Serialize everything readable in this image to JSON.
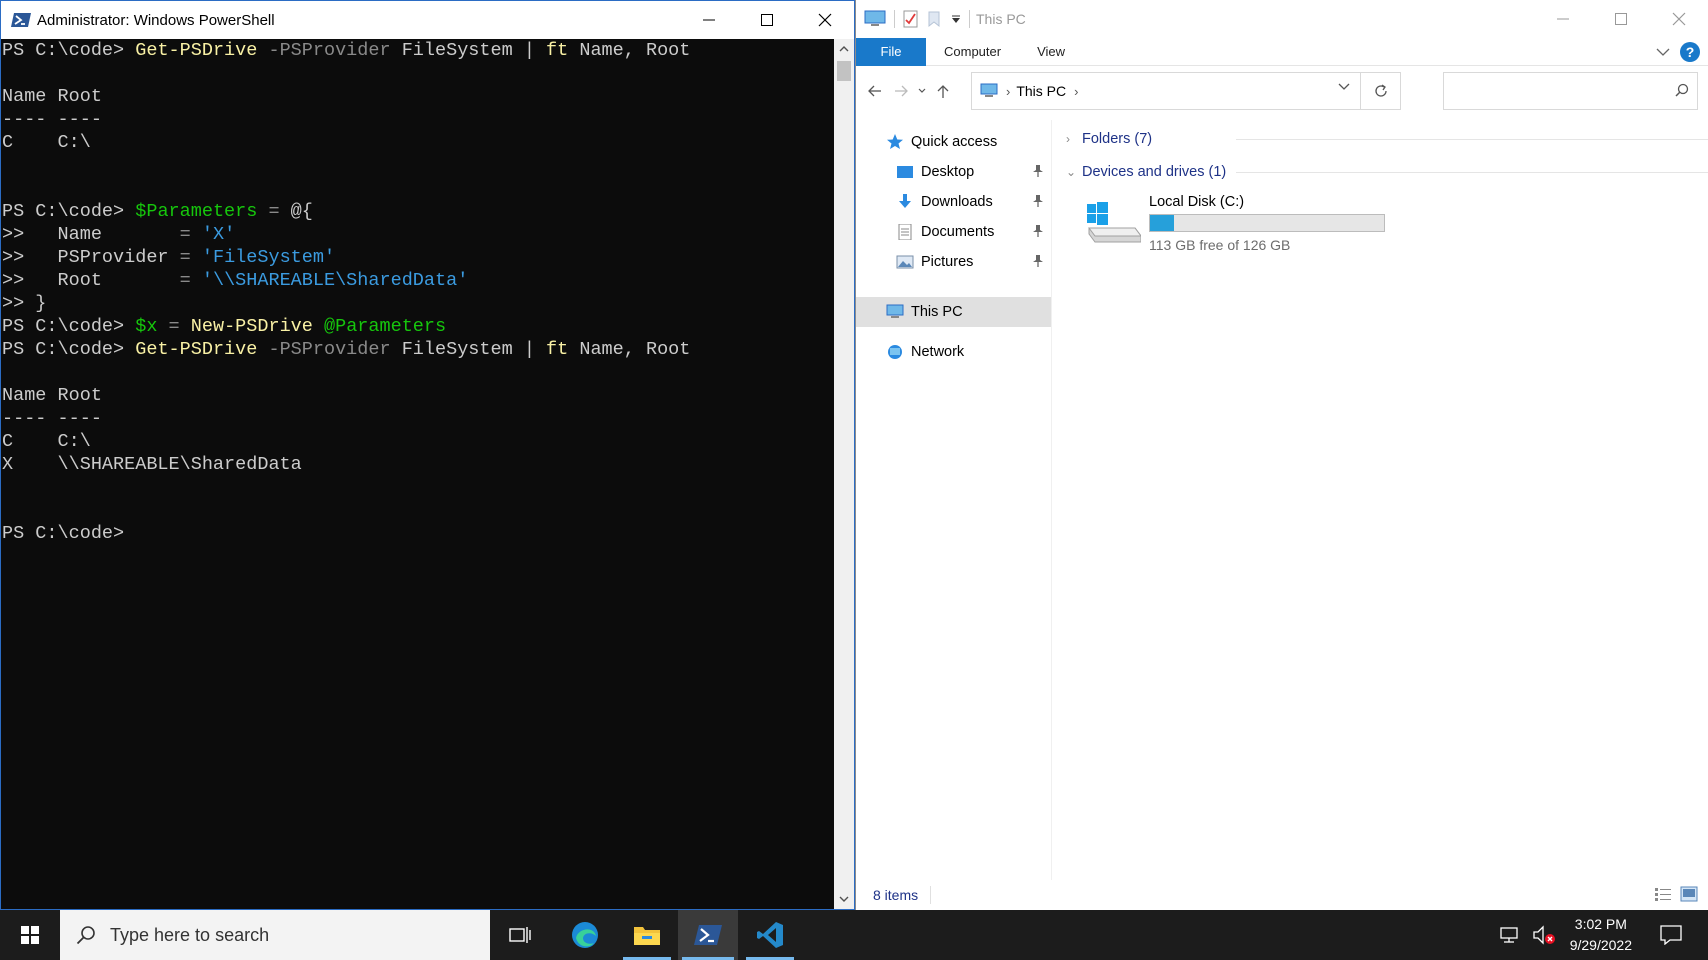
{
  "powershell": {
    "title": "Administrator: Windows PowerShell",
    "lines": [
      [
        {
          "t": "PS C:\\code> ",
          "c": ""
        },
        {
          "t": "Get-PSDrive",
          "c": "c-cmd"
        },
        {
          "t": " -PSProvider",
          "c": "c-param"
        },
        {
          "t": " FileSystem | ",
          "c": ""
        },
        {
          "t": "ft",
          "c": "c-cmd"
        },
        {
          "t": " Name, Root",
          "c": ""
        }
      ],
      [],
      [
        {
          "t": "Name Root",
          "c": ""
        }
      ],
      [
        {
          "t": "---- ----",
          "c": ""
        }
      ],
      [
        {
          "t": "C    C:\\",
          "c": ""
        }
      ],
      [],
      [],
      [
        {
          "t": "PS C:\\code> ",
          "c": ""
        },
        {
          "t": "$Parameters",
          "c": "c-var"
        },
        {
          "t": " = ",
          "c": "c-op"
        },
        {
          "t": "@{",
          "c": ""
        }
      ],
      [
        {
          "t": ">>   Name       ",
          "c": ""
        },
        {
          "t": "= ",
          "c": "c-op"
        },
        {
          "t": "'X'",
          "c": "c-str"
        }
      ],
      [
        {
          "t": ">>   PSProvider ",
          "c": ""
        },
        {
          "t": "= ",
          "c": "c-op"
        },
        {
          "t": "'FileSystem'",
          "c": "c-str"
        }
      ],
      [
        {
          "t": ">>   Root       ",
          "c": ""
        },
        {
          "t": "= ",
          "c": "c-op"
        },
        {
          "t": "'\\\\SHAREABLE\\SharedData'",
          "c": "c-str"
        }
      ],
      [
        {
          "t": ">> }",
          "c": ""
        }
      ],
      [
        {
          "t": "PS C:\\code> ",
          "c": ""
        },
        {
          "t": "$x",
          "c": "c-var"
        },
        {
          "t": " = ",
          "c": "c-op"
        },
        {
          "t": "New-PSDrive",
          "c": "c-cmd"
        },
        {
          "t": " @Parameters",
          "c": "c-var"
        }
      ],
      [
        {
          "t": "PS C:\\code> ",
          "c": ""
        },
        {
          "t": "Get-PSDrive",
          "c": "c-cmd"
        },
        {
          "t": " -PSProvider",
          "c": "c-param"
        },
        {
          "t": " FileSystem | ",
          "c": ""
        },
        {
          "t": "ft",
          "c": "c-cmd"
        },
        {
          "t": " Name, Root",
          "c": ""
        }
      ],
      [],
      [
        {
          "t": "Name Root",
          "c": ""
        }
      ],
      [
        {
          "t": "---- ----",
          "c": ""
        }
      ],
      [
        {
          "t": "C    C:\\",
          "c": ""
        }
      ],
      [
        {
          "t": "X    \\\\SHAREABLE\\SharedData",
          "c": ""
        }
      ],
      [],
      [],
      [
        {
          "t": "PS C:\\code>",
          "c": ""
        }
      ]
    ]
  },
  "explorer": {
    "title": "This PC",
    "ribbon_tabs": [
      "File",
      "Computer",
      "View"
    ],
    "address": "This PC",
    "nav_pane": {
      "quick_access": "Quick access",
      "pinned": [
        "Desktop",
        "Downloads",
        "Documents",
        "Pictures"
      ],
      "this_pc": "This PC",
      "network": "Network"
    },
    "groups": {
      "folders": "Folders (7)",
      "devices": "Devices and drives (1)"
    },
    "drive": {
      "name": "Local Disk (C:)",
      "free_text": "113 GB free of 126 GB",
      "used_fraction": 0.103
    },
    "status": "8 items",
    "help": "?"
  },
  "taskbar": {
    "search_placeholder": "Type here to search",
    "time": "3:02 PM",
    "date": "9/29/2022"
  },
  "colors": {
    "accent": "#1979ca",
    "drive_fill": "#26a0da",
    "console_bg": "#0c0c0c",
    "taskbar_bg": "#1c1c1c"
  }
}
